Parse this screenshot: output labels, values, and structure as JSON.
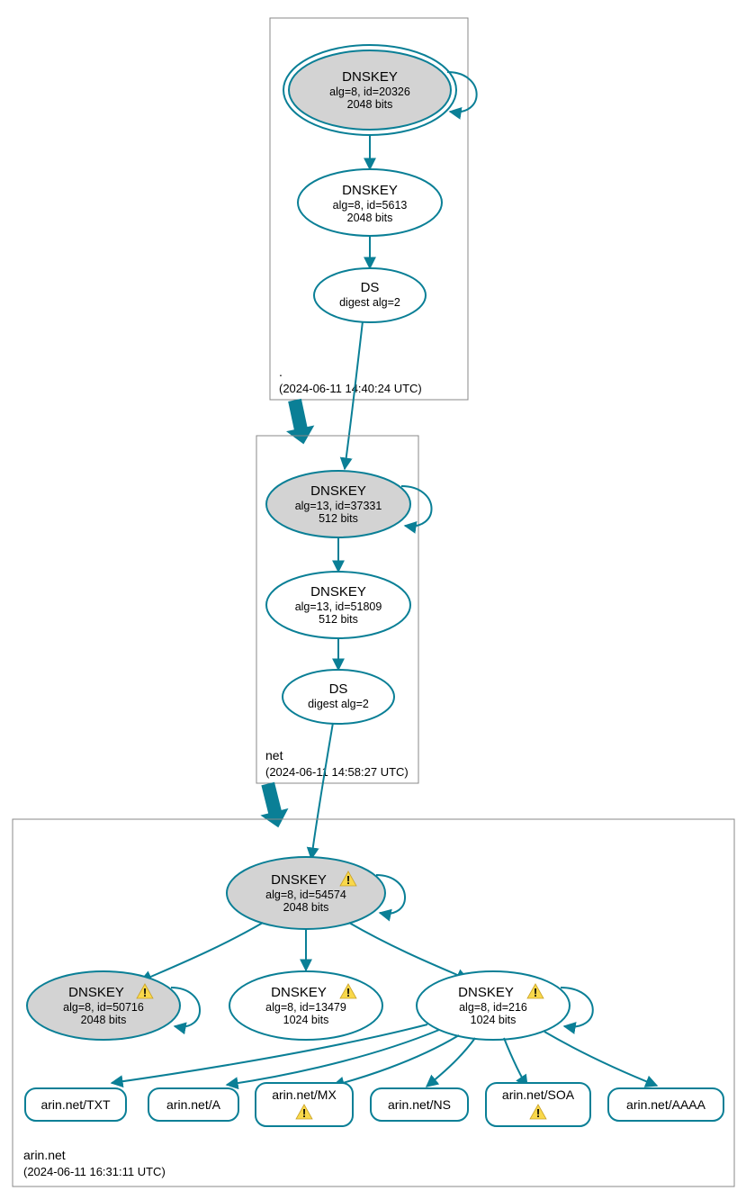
{
  "zones": {
    "root": {
      "name": ".",
      "timestamp": "(2024-06-11 14:40:24 UTC)"
    },
    "net": {
      "name": "net",
      "timestamp": "(2024-06-11 14:58:27 UTC)"
    },
    "arin": {
      "name": "arin.net",
      "timestamp": "(2024-06-11 16:31:11 UTC)"
    }
  },
  "nodes": {
    "root_ksk": {
      "title": "DNSKEY",
      "line1": "alg=8, id=20326",
      "line2": "2048 bits"
    },
    "root_zsk": {
      "title": "DNSKEY",
      "line1": "alg=8, id=5613",
      "line2": "2048 bits"
    },
    "root_ds": {
      "title": "DS",
      "line1": "digest alg=2",
      "line2": ""
    },
    "net_ksk": {
      "title": "DNSKEY",
      "line1": "alg=13, id=37331",
      "line2": "512 bits"
    },
    "net_zsk": {
      "title": "DNSKEY",
      "line1": "alg=13, id=51809",
      "line2": "512 bits"
    },
    "net_ds": {
      "title": "DS",
      "line1": "digest alg=2",
      "line2": ""
    },
    "arin_ksk": {
      "title": "DNSKEY",
      "line1": "alg=8, id=54574",
      "line2": "2048 bits"
    },
    "arin_50716": {
      "title": "DNSKEY",
      "line1": "alg=8, id=50716",
      "line2": "2048 bits"
    },
    "arin_13479": {
      "title": "DNSKEY",
      "line1": "alg=8, id=13479",
      "line2": "1024 bits"
    },
    "arin_216": {
      "title": "DNSKEY",
      "line1": "alg=8, id=216",
      "line2": "1024 bits"
    }
  },
  "rr": {
    "txt": "arin.net/TXT",
    "a": "arin.net/A",
    "mx": "arin.net/MX",
    "ns": "arin.net/NS",
    "soa": "arin.net/SOA",
    "aaaa": "arin.net/AAAA"
  },
  "colors": {
    "stroke": "#0a7f96",
    "trust_fill": "#d3d3d3"
  }
}
